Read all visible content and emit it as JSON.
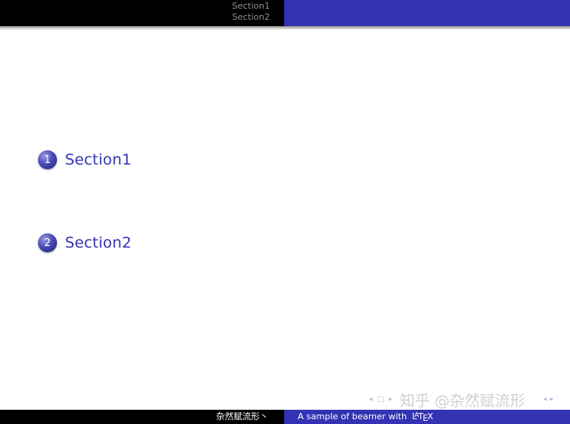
{
  "header": {
    "nav_items": [
      "Section1",
      "Section2"
    ]
  },
  "toc": {
    "items": [
      {
        "number": "1",
        "label": "Section1"
      },
      {
        "number": "2",
        "label": "Section2"
      }
    ]
  },
  "nav_controls": {
    "left": [
      "◂",
      "□",
      "▸"
    ],
    "right": [
      "◂",
      "◂"
    ]
  },
  "watermark": "知乎 @杂然赋流形",
  "footer": {
    "author": "杂然赋流形丶",
    "title": "A sample of beamer with",
    "latex_logo": "LaTeX"
  },
  "colors": {
    "header_left": "#000000",
    "theme_blue": "#3333b3",
    "section_text": "#3333b3",
    "nav_dim_text": "#8c8c8c"
  }
}
